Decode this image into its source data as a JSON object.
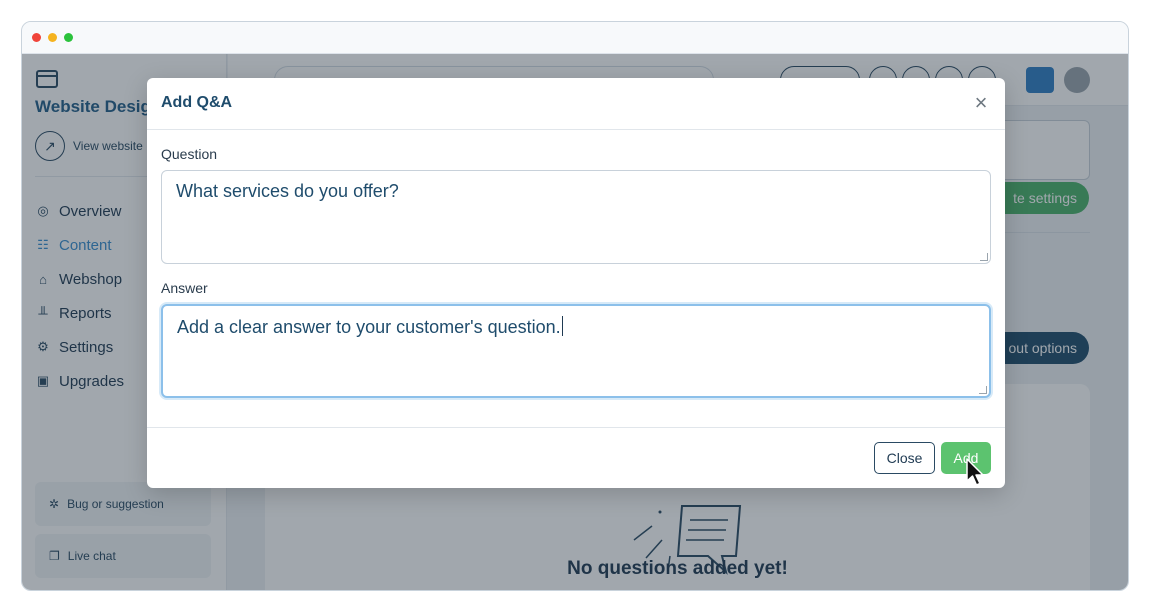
{
  "sidebar": {
    "title": "Website Desig",
    "view_website": "View website",
    "items": [
      {
        "label": "Overview",
        "icon": "overview-icon"
      },
      {
        "label": "Content",
        "icon": "content-icon"
      },
      {
        "label": "Webshop",
        "icon": "basket-icon"
      },
      {
        "label": "Reports",
        "icon": "reports-icon"
      },
      {
        "label": "Settings",
        "icon": "gear-icon"
      },
      {
        "label": "Upgrades",
        "icon": "upgrades-icon"
      }
    ],
    "bottom": [
      {
        "label": "Bug or suggestion",
        "icon": "bug-icon"
      },
      {
        "label": "Live chat",
        "icon": "chat-icon"
      }
    ]
  },
  "background": {
    "settings_button": "te settings",
    "options_button": "out options",
    "empty_text": "No questions added yet!"
  },
  "modal": {
    "title": "Add Q&A",
    "question_label": "Question",
    "question_value": "What services do you offer?",
    "answer_label": "Answer",
    "answer_value": "Add a clear answer to your customer's question.",
    "close_label": "Close",
    "add_label": "Add"
  },
  "colors": {
    "accent": "#1f4c6c",
    "add_button": "#5cc36f",
    "focus_border": "#8cc0ea"
  }
}
